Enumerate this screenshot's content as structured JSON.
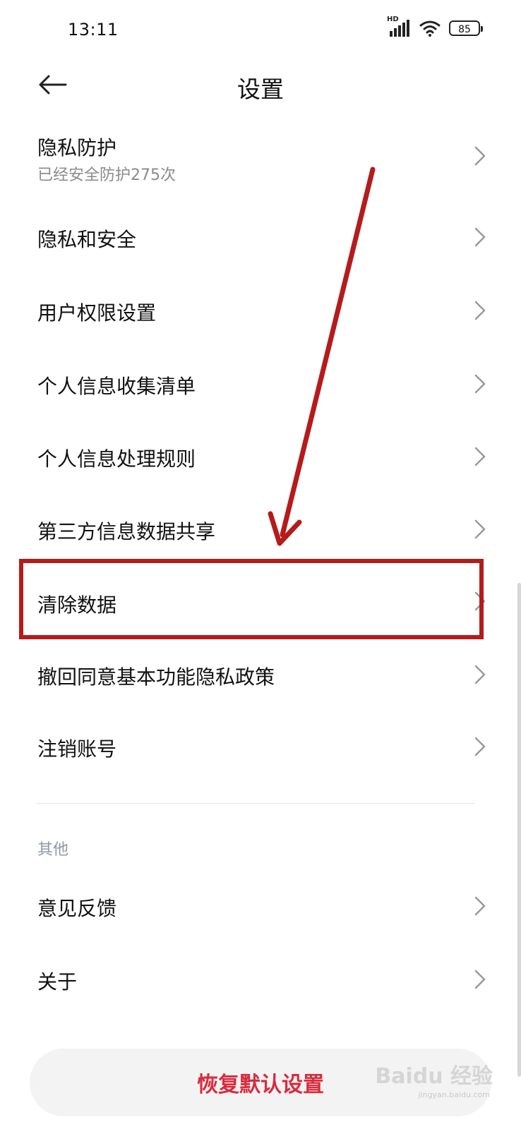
{
  "status_bar": {
    "time": "13:11",
    "network_label": "HD",
    "battery_level": "85"
  },
  "header": {
    "title": "设置",
    "back_icon": "arrow-left-icon"
  },
  "menu": {
    "items": [
      {
        "label": "隐私防护",
        "subtitle": "已经安全防护275次"
      },
      {
        "label": "隐私和安全"
      },
      {
        "label": "用户权限设置"
      },
      {
        "label": "个人信息收集清单"
      },
      {
        "label": "个人信息处理规则"
      },
      {
        "label": "第三方信息数据共享"
      },
      {
        "label": "清除数据",
        "highlighted": true
      },
      {
        "label": "撤回同意基本功能隐私政策"
      },
      {
        "label": "注销账号"
      }
    ]
  },
  "other_section": {
    "title": "其他",
    "items": [
      {
        "label": "意见反馈"
      },
      {
        "label": "关于"
      }
    ]
  },
  "footer": {
    "reset_label": "恢复默认设置"
  },
  "watermark": {
    "text": "Baidu 经验",
    "sub": "jingyan.baidu.com"
  },
  "colors": {
    "accent_red": "#d82c3e",
    "annotation_red": "#b51b1b",
    "secondary_text": "#8a8a8a"
  }
}
